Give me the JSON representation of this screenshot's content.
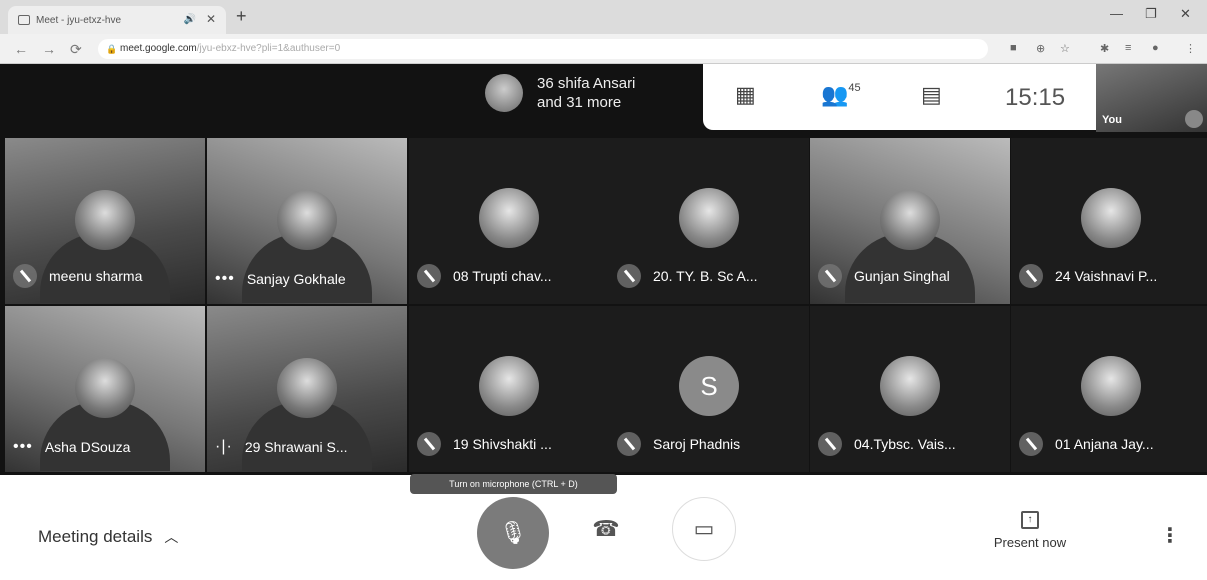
{
  "browser": {
    "tab_title": "Meet - jyu-etxz-hve",
    "url_host": "meet.google.com",
    "url_path": "/jyu-ebxz-hve?pli=1&authuser=0"
  },
  "meet": {
    "presenting": {
      "line1": "36 shifa Ansari",
      "line2": "and 31 more"
    },
    "participants_count": "45",
    "time": "15:15",
    "self_label": "You",
    "tiles": [
      {
        "name": "meenu sharma"
      },
      {
        "name": "Sanjay Gokhale"
      },
      {
        "name": "08 Trupti chav..."
      },
      {
        "name": "20. TY. B. Sc A..."
      },
      {
        "name": "Gunjan Singhal"
      },
      {
        "name": "24 Vaishnavi P..."
      },
      {
        "name": "Asha DSouza"
      },
      {
        "name": "29 Shrawani S..."
      },
      {
        "name": "19 Shivshakti ..."
      },
      {
        "name": "Saroj Phadnis",
        "initial": "S"
      },
      {
        "name": "04.Tybsc. Vais..."
      },
      {
        "name": "01 Anjana Jay..."
      }
    ],
    "tooltip": "Turn on microphone (CTRL + D)",
    "meeting_details": "Meeting details",
    "present_now": "Present now"
  },
  "icons": {
    "mic_off": "mic-off-icon",
    "hangup": "hangup-icon",
    "camera": "camera-icon",
    "people": "people-icon",
    "chat": "chat-icon",
    "layout": "grid-layout-icon",
    "present": "present-icon",
    "more": "more-vert-icon"
  }
}
